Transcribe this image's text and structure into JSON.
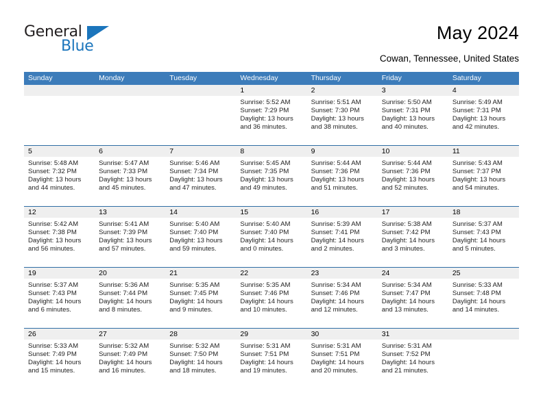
{
  "logo": {
    "primary_text": "General",
    "secondary_text": "Blue",
    "triangle_color": "#1b75bc"
  },
  "header": {
    "title": "May 2024",
    "location": "Cowan, Tennessee, United States"
  },
  "colors": {
    "header_band": "#3c7cba",
    "row_separator": "#2e6da4",
    "day_number_band": "#efefef"
  },
  "weekdays": [
    "Sunday",
    "Monday",
    "Tuesday",
    "Wednesday",
    "Thursday",
    "Friday",
    "Saturday"
  ],
  "weeks": [
    [
      {
        "day": "",
        "lines": []
      },
      {
        "day": "",
        "lines": []
      },
      {
        "day": "",
        "lines": []
      },
      {
        "day": "1",
        "lines": [
          "Sunrise: 5:52 AM",
          "Sunset: 7:29 PM",
          "Daylight: 13 hours",
          "and 36 minutes."
        ]
      },
      {
        "day": "2",
        "lines": [
          "Sunrise: 5:51 AM",
          "Sunset: 7:30 PM",
          "Daylight: 13 hours",
          "and 38 minutes."
        ]
      },
      {
        "day": "3",
        "lines": [
          "Sunrise: 5:50 AM",
          "Sunset: 7:31 PM",
          "Daylight: 13 hours",
          "and 40 minutes."
        ]
      },
      {
        "day": "4",
        "lines": [
          "Sunrise: 5:49 AM",
          "Sunset: 7:31 PM",
          "Daylight: 13 hours",
          "and 42 minutes."
        ]
      }
    ],
    [
      {
        "day": "5",
        "lines": [
          "Sunrise: 5:48 AM",
          "Sunset: 7:32 PM",
          "Daylight: 13 hours",
          "and 44 minutes."
        ]
      },
      {
        "day": "6",
        "lines": [
          "Sunrise: 5:47 AM",
          "Sunset: 7:33 PM",
          "Daylight: 13 hours",
          "and 45 minutes."
        ]
      },
      {
        "day": "7",
        "lines": [
          "Sunrise: 5:46 AM",
          "Sunset: 7:34 PM",
          "Daylight: 13 hours",
          "and 47 minutes."
        ]
      },
      {
        "day": "8",
        "lines": [
          "Sunrise: 5:45 AM",
          "Sunset: 7:35 PM",
          "Daylight: 13 hours",
          "and 49 minutes."
        ]
      },
      {
        "day": "9",
        "lines": [
          "Sunrise: 5:44 AM",
          "Sunset: 7:36 PM",
          "Daylight: 13 hours",
          "and 51 minutes."
        ]
      },
      {
        "day": "10",
        "lines": [
          "Sunrise: 5:44 AM",
          "Sunset: 7:36 PM",
          "Daylight: 13 hours",
          "and 52 minutes."
        ]
      },
      {
        "day": "11",
        "lines": [
          "Sunrise: 5:43 AM",
          "Sunset: 7:37 PM",
          "Daylight: 13 hours",
          "and 54 minutes."
        ]
      }
    ],
    [
      {
        "day": "12",
        "lines": [
          "Sunrise: 5:42 AM",
          "Sunset: 7:38 PM",
          "Daylight: 13 hours",
          "and 56 minutes."
        ]
      },
      {
        "day": "13",
        "lines": [
          "Sunrise: 5:41 AM",
          "Sunset: 7:39 PM",
          "Daylight: 13 hours",
          "and 57 minutes."
        ]
      },
      {
        "day": "14",
        "lines": [
          "Sunrise: 5:40 AM",
          "Sunset: 7:40 PM",
          "Daylight: 13 hours",
          "and 59 minutes."
        ]
      },
      {
        "day": "15",
        "lines": [
          "Sunrise: 5:40 AM",
          "Sunset: 7:40 PM",
          "Daylight: 14 hours",
          "and 0 minutes."
        ]
      },
      {
        "day": "16",
        "lines": [
          "Sunrise: 5:39 AM",
          "Sunset: 7:41 PM",
          "Daylight: 14 hours",
          "and 2 minutes."
        ]
      },
      {
        "day": "17",
        "lines": [
          "Sunrise: 5:38 AM",
          "Sunset: 7:42 PM",
          "Daylight: 14 hours",
          "and 3 minutes."
        ]
      },
      {
        "day": "18",
        "lines": [
          "Sunrise: 5:37 AM",
          "Sunset: 7:43 PM",
          "Daylight: 14 hours",
          "and 5 minutes."
        ]
      }
    ],
    [
      {
        "day": "19",
        "lines": [
          "Sunrise: 5:37 AM",
          "Sunset: 7:43 PM",
          "Daylight: 14 hours",
          "and 6 minutes."
        ]
      },
      {
        "day": "20",
        "lines": [
          "Sunrise: 5:36 AM",
          "Sunset: 7:44 PM",
          "Daylight: 14 hours",
          "and 8 minutes."
        ]
      },
      {
        "day": "21",
        "lines": [
          "Sunrise: 5:35 AM",
          "Sunset: 7:45 PM",
          "Daylight: 14 hours",
          "and 9 minutes."
        ]
      },
      {
        "day": "22",
        "lines": [
          "Sunrise: 5:35 AM",
          "Sunset: 7:46 PM",
          "Daylight: 14 hours",
          "and 10 minutes."
        ]
      },
      {
        "day": "23",
        "lines": [
          "Sunrise: 5:34 AM",
          "Sunset: 7:46 PM",
          "Daylight: 14 hours",
          "and 12 minutes."
        ]
      },
      {
        "day": "24",
        "lines": [
          "Sunrise: 5:34 AM",
          "Sunset: 7:47 PM",
          "Daylight: 14 hours",
          "and 13 minutes."
        ]
      },
      {
        "day": "25",
        "lines": [
          "Sunrise: 5:33 AM",
          "Sunset: 7:48 PM",
          "Daylight: 14 hours",
          "and 14 minutes."
        ]
      }
    ],
    [
      {
        "day": "26",
        "lines": [
          "Sunrise: 5:33 AM",
          "Sunset: 7:49 PM",
          "Daylight: 14 hours",
          "and 15 minutes."
        ]
      },
      {
        "day": "27",
        "lines": [
          "Sunrise: 5:32 AM",
          "Sunset: 7:49 PM",
          "Daylight: 14 hours",
          "and 16 minutes."
        ]
      },
      {
        "day": "28",
        "lines": [
          "Sunrise: 5:32 AM",
          "Sunset: 7:50 PM",
          "Daylight: 14 hours",
          "and 18 minutes."
        ]
      },
      {
        "day": "29",
        "lines": [
          "Sunrise: 5:31 AM",
          "Sunset: 7:51 PM",
          "Daylight: 14 hours",
          "and 19 minutes."
        ]
      },
      {
        "day": "30",
        "lines": [
          "Sunrise: 5:31 AM",
          "Sunset: 7:51 PM",
          "Daylight: 14 hours",
          "and 20 minutes."
        ]
      },
      {
        "day": "31",
        "lines": [
          "Sunrise: 5:31 AM",
          "Sunset: 7:52 PM",
          "Daylight: 14 hours",
          "and 21 minutes."
        ]
      },
      {
        "day": "",
        "lines": []
      }
    ]
  ]
}
